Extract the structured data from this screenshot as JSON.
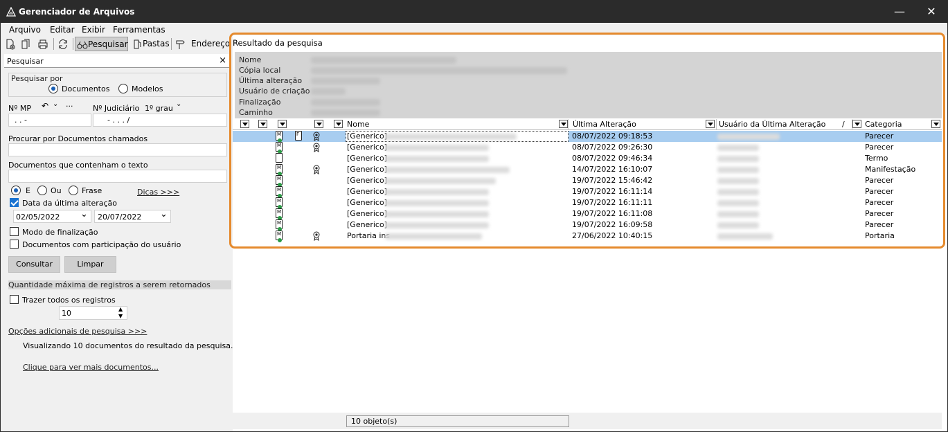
{
  "window": {
    "title": "Gerenciador de Arquivos"
  },
  "menu": [
    "Arquivo",
    "Editar",
    "Exibir",
    "Ferramentas"
  ],
  "toolbar": {
    "pesquisar": "Pesquisar",
    "pastas": "Pastas",
    "endereco": "Endereço"
  },
  "search_panel": {
    "title": "Pesquisar",
    "pesquisar_por": "Pesquisar por",
    "opt_documentos": "Documentos",
    "opt_modelos": "Modelos",
    "n_mp_label": "Nº MP",
    "n_mp_value": ".    .      -",
    "n_jud_label": "Nº Judiciário",
    "grau": "1º grau",
    "n_jud_value": "-    .   .   .   /",
    "procurar_label": "Procurar por Documentos chamados",
    "contenham_label": "Documentos que contenham o texto",
    "opt_e": "E",
    "opt_ou": "Ou",
    "opt_frase": "Frase",
    "dicas": "Dicas >>>",
    "data_ultima": "Data da última alteração",
    "date_from": "02/05/2022",
    "date_to": "20/07/2022",
    "modo_final": "Modo de finalização",
    "docs_part": "Documentos com participação do usuário",
    "btn_consultar": "Consultar",
    "btn_limpar": "Limpar",
    "qtd_max": "Quantidade máxima de registros a serem retornados",
    "trazer_todos": "Trazer todos os registros",
    "qtd_value": "10",
    "opcoes_adic": "Opções adicionais de pesquisa >>>",
    "visualizando": "Visualizando 10 documentos do resultado da pesquisa.",
    "clique_mais": "Clique para ver mais documentos..."
  },
  "results": {
    "title": "Resultado da pesquisa",
    "props": [
      "Nome",
      "Cópia local",
      "Última alteração",
      "Usuário de criação",
      "Finalização",
      "Caminho"
    ],
    "headers": {
      "nome": "Nome",
      "ultima": "Última Alteração",
      "usuario": "Usuário da Última Alteração",
      "sort": "/",
      "categoria": "Categoria"
    },
    "rows": [
      {
        "nome": "[Generico]",
        "data": "08/07/2022 09:18:53",
        "categoria": "Parecer",
        "selected": true
      },
      {
        "nome": "[Generico]",
        "data": "08/07/2022 09:26:30",
        "categoria": "Parecer"
      },
      {
        "nome": "[Generico]",
        "data": "08/07/2022 09:46:34",
        "categoria": "Termo"
      },
      {
        "nome": "[Generico]",
        "data": "14/07/2022 16:10:07",
        "categoria": "Manifestação"
      },
      {
        "nome": "[Generico]",
        "data": "19/07/2022 15:46:42",
        "categoria": "Parecer"
      },
      {
        "nome": "[Generico]",
        "data": "19/07/2022 16:11:14",
        "categoria": "Parecer"
      },
      {
        "nome": "[Generico]",
        "data": "19/07/2022 16:11:11",
        "categoria": "Parecer"
      },
      {
        "nome": "[Generico]",
        "data": "19/07/2022 16:11:08",
        "categoria": "Parecer"
      },
      {
        "nome": "[Generico]",
        "data": "19/07/2022 16:09:58",
        "categoria": "Parecer"
      },
      {
        "nome": "Portaria ins",
        "data": "27/06/2022 10:40:15",
        "categoria": "Portaria"
      }
    ],
    "status": "10 objeto(s)"
  }
}
